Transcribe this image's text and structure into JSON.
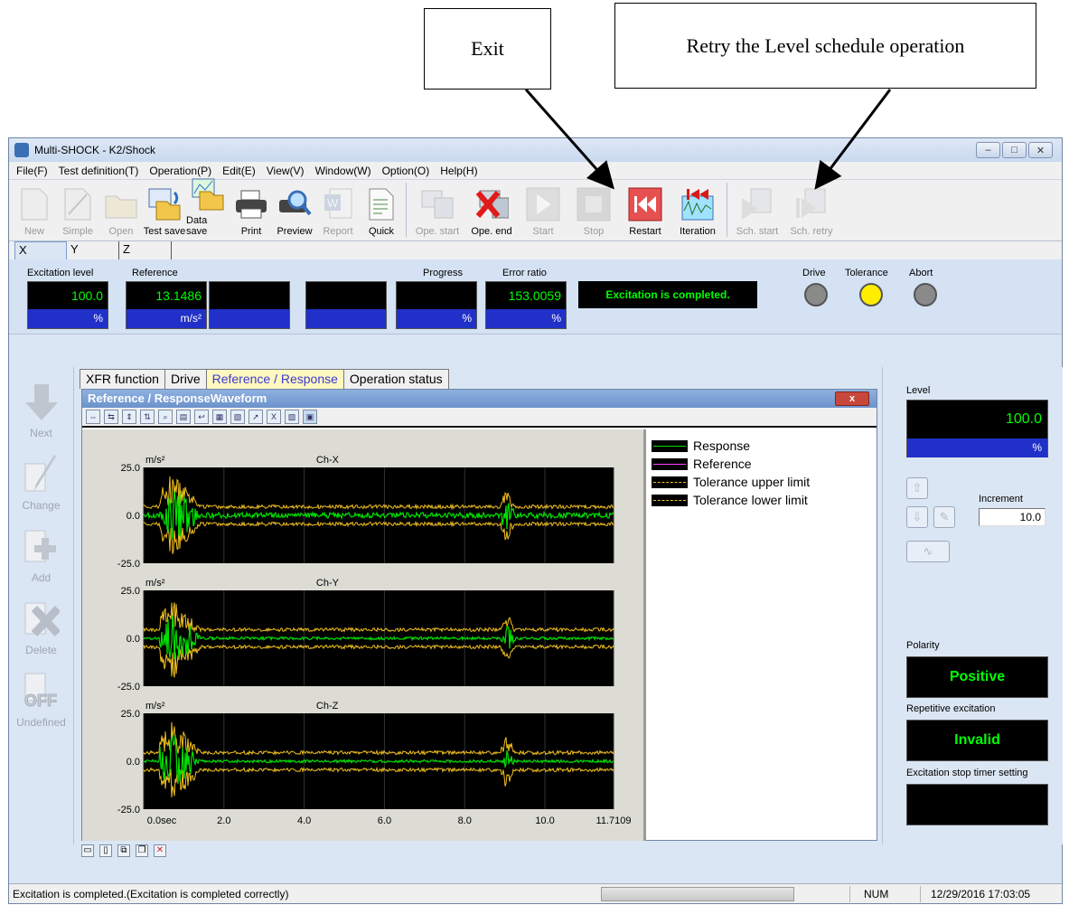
{
  "callouts": {
    "exit": "Exit",
    "retry": "Retry the Level schedule operation"
  },
  "window": {
    "title": "Multi-SHOCK - K2/Shock"
  },
  "menu": [
    "File(F)",
    "Test definition(T)",
    "Operation(P)",
    "Edit(E)",
    "View(V)",
    "Window(W)",
    "Option(O)",
    "Help(H)"
  ],
  "toolbar": {
    "new": "New",
    "simple": "Simple",
    "open": "Open",
    "test_save": "Test save",
    "data_save": "Data save",
    "print": "Print",
    "preview": "Preview",
    "report": "Report",
    "quick": "Quick",
    "ope_start": "Ope. start",
    "ope_end": "Ope. end",
    "start": "Start",
    "stop": "Stop",
    "restart": "Restart",
    "iteration": "Iteration",
    "sch_start": "Sch. start",
    "sch_retry": "Sch. retry"
  },
  "axis_tabs": [
    "X",
    "Y",
    "Z"
  ],
  "monitor": {
    "excitation_level_label": "Excitation level",
    "reference_label": "Reference",
    "progress_label": "Progress",
    "error_ratio_label": "Error ratio",
    "excitation_level_value": "100.0",
    "excitation_level_unit": "%",
    "reference_value": "13.1486",
    "reference_unit": "m/s²",
    "progress_unit": "%",
    "error_ratio_value": "153.0059",
    "error_ratio_unit": "%",
    "status_message": "Excitation is completed.",
    "drive_label": "Drive",
    "tolerance_label": "Tolerance",
    "abort_label": "Abort",
    "drive_color": "#8a8a8a",
    "tolerance_color": "#ffee00",
    "abort_color": "#8a8a8a"
  },
  "left_panel": {
    "next": "Next",
    "change": "Change",
    "add": "Add",
    "delete": "Delete",
    "undefined": "Undefined",
    "off_icon_text": "OFF"
  },
  "view_tabs": [
    "XFR function",
    "Drive",
    "Reference / Response",
    "Operation status"
  ],
  "graph": {
    "title": "Reference / ResponseWaveform",
    "close": "x",
    "unit": "m/s²",
    "channels": [
      "Ch-X",
      "Ch-Y",
      "Ch-Z"
    ],
    "x_ticks": [
      "0.0sec",
      "2.0",
      "4.0",
      "6.0",
      "8.0",
      "10.0",
      "11.7109"
    ],
    "legend": [
      "Response",
      "Reference",
      "Tolerance upper limit",
      "Tolerance lower limit"
    ],
    "colors": {
      "response": "#00e000",
      "reference": "#ff40ff",
      "tolerance": "#f0c020"
    }
  },
  "chart_data": {
    "type": "line",
    "x_range": [
      0.0,
      11.7109
    ],
    "x_unit": "sec",
    "x_ticks": [
      0.0,
      2.0,
      4.0,
      6.0,
      8.0,
      10.0,
      11.7109
    ],
    "ylabel": "m/s²",
    "ylim": [
      -25.0,
      25.0
    ],
    "y_ticks": [
      25.0,
      0.0,
      -25.0
    ],
    "panels": [
      "Ch-X",
      "Ch-Y",
      "Ch-Z"
    ],
    "series": [
      {
        "name": "Response"
      },
      {
        "name": "Reference"
      },
      {
        "name": "Tolerance upper limit"
      },
      {
        "name": "Tolerance lower limit"
      }
    ],
    "legend_position": "right"
  },
  "right_panel": {
    "level_label": "Level",
    "level_value": "100.0",
    "level_unit": "%",
    "increment_label": "Increment",
    "increment_value": "10.0",
    "polarity_label": "Polarity",
    "polarity_value": "Positive",
    "repetitive_label": "Repetitive excitation",
    "repetitive_value": "Invalid",
    "stop_timer_label": "Excitation stop timer setting"
  },
  "statusbar": {
    "message": "Excitation is completed.(Excitation is completed correctly)",
    "num": "NUM",
    "datetime": "12/29/2016  17:03:05"
  }
}
